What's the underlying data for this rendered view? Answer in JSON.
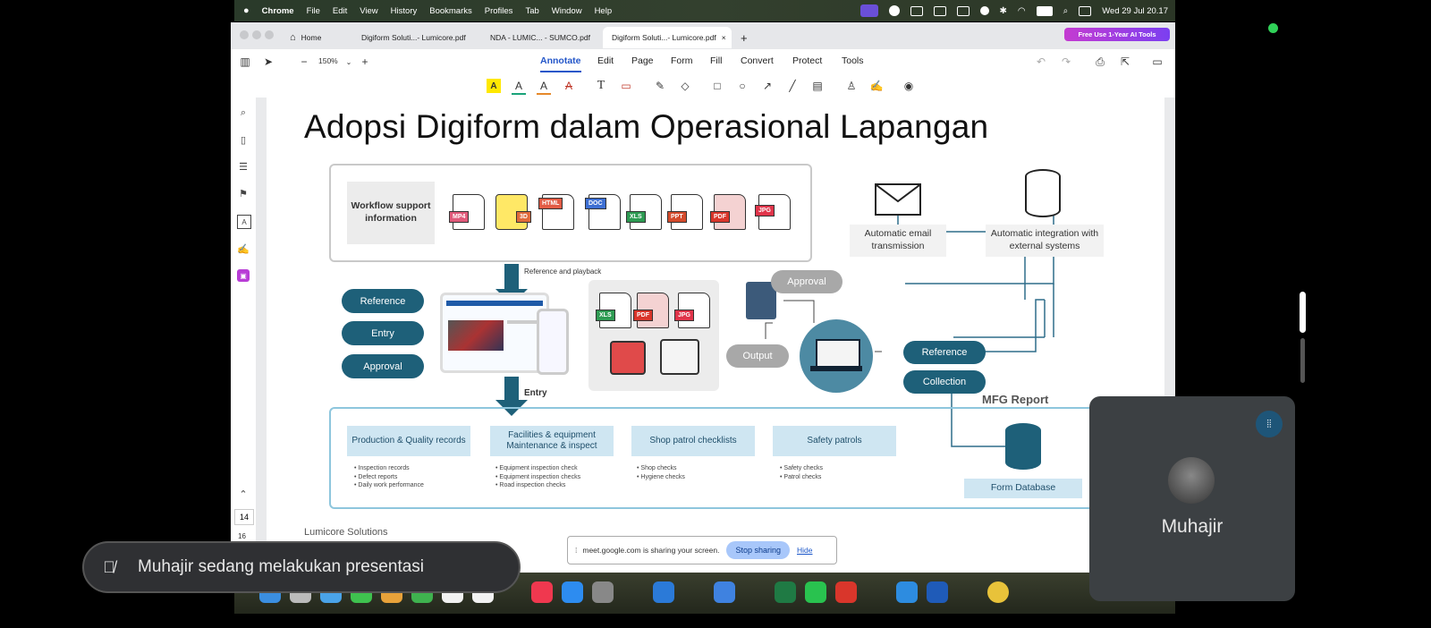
{
  "menubar": {
    "items": [
      "Chrome",
      "File",
      "Edit",
      "View",
      "History",
      "Bookmarks",
      "Profiles",
      "Tab",
      "Window",
      "Help"
    ],
    "datetime": "Wed 29 Jul 20.17"
  },
  "browser": {
    "tabs": [
      {
        "label": "Home"
      },
      {
        "label": "Digiform Soluti...- Lumicore.pdf"
      },
      {
        "label": "NDA - LUMIC... - SUMCO.pdf"
      },
      {
        "label": "Digiform Soluti...- Lumicore.pdf"
      }
    ],
    "new_tab": "+",
    "promo": "Free Use 1-Year AI Tools"
  },
  "toolbar": {
    "zoom": "150%",
    "menus": [
      "Annotate",
      "Edit",
      "Page",
      "Form",
      "Fill",
      "Convert",
      "Protect",
      "Tools"
    ],
    "active_menu": "Annotate"
  },
  "sidebar": {
    "page_current": "14",
    "page_next": "16"
  },
  "slide": {
    "title": "Adopsi Digiform dalam Operasional Lapangan",
    "workflow_label": "Workflow support information",
    "file_types": [
      "MP4",
      "3D",
      "HTML",
      "DOC",
      "XLS",
      "PPT",
      "PDF",
      "JPG"
    ],
    "ref_playback": "Reference and playback",
    "entry_label": "Entry",
    "left_pills": [
      "Reference",
      "Entry",
      "Approval"
    ],
    "output_files": [
      "XLS",
      "PDF",
      "JPG"
    ],
    "approval": "Approval",
    "output": "Output",
    "right_pills": [
      "Reference",
      "Collection"
    ],
    "mfg_report": "MFG Report",
    "email_label": "Automatic email transmission",
    "integration_label": "Automatic integration with external systems",
    "form_db": "Form Database",
    "categories": [
      {
        "title": "Production & Quality records",
        "items": [
          "Inspection records",
          "Defect reports",
          "Daily work performance"
        ]
      },
      {
        "title": "Facilities & equipment Maintenance & inspect",
        "items": [
          "Equipment inspection check",
          "Equipment inspection checks",
          "Road inspection checks"
        ]
      },
      {
        "title": "Shop patrol checklists",
        "items": [
          "Shop checks",
          "Hygiene checks"
        ]
      },
      {
        "title": "Safety patrols",
        "items": [
          "Safety checks",
          "Patrol checks"
        ]
      }
    ],
    "footer": "Lumicore Solutions"
  },
  "meet": {
    "presenting": "Muhajir sedang melakukan presentasi",
    "sharing_text": "meet.google.com is sharing your screen.",
    "stop_sharing": "Stop sharing",
    "hide": "Hide",
    "participant_name": "Muhajir"
  },
  "colors": {
    "accent": "#2356c9",
    "pill_dark": "#1e6079",
    "cat_bg": "#cfe6f2",
    "promo": "#9b3ef0"
  }
}
